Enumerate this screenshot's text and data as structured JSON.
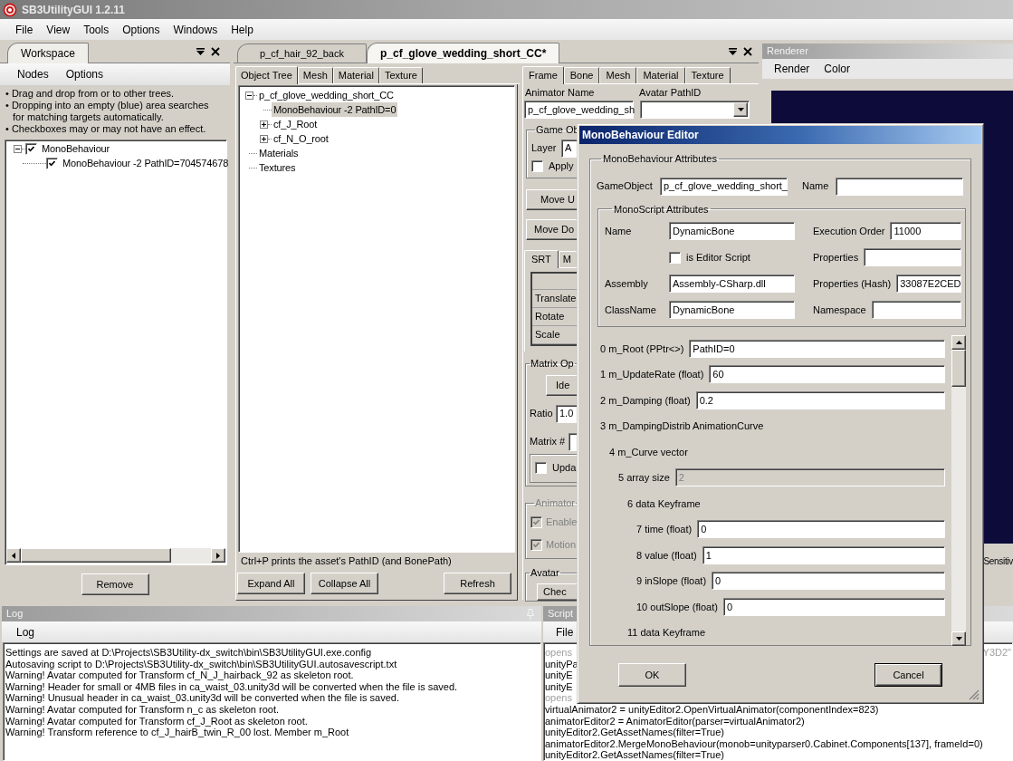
{
  "window": {
    "title": "SB3UtilityGUI 1.2.11"
  },
  "menu": [
    "File",
    "View",
    "Tools",
    "Options",
    "Windows",
    "Help"
  ],
  "workspace": {
    "tab": "Workspace",
    "menu": [
      "Nodes",
      "Options"
    ],
    "hints": [
      "• Drag and drop from or to other trees.",
      "• Dropping into an empty (blue) area searches for matching targets automatically.",
      "• Checkboxes may or may not have an effect."
    ],
    "tree": [
      {
        "label": "MonoBehaviour",
        "checked": true,
        "expanded": true,
        "children": [
          {
            "label": "MonoBehaviour -2 PathID=704574678",
            "checked": true
          }
        ]
      }
    ],
    "remove_button": "Remove"
  },
  "document_tabs": [
    {
      "label": "p_cf_hair_92_back",
      "selected": false
    },
    {
      "label": "p_cf_glove_wedding_short_CC*",
      "selected": true
    }
  ],
  "object_panel": {
    "tabs": [
      {
        "label": "Object Tree",
        "selected": true
      },
      {
        "label": "Mesh",
        "selected": false
      },
      {
        "label": "Material",
        "selected": false
      },
      {
        "label": "Texture",
        "selected": false
      }
    ],
    "tree": [
      {
        "label": "p_cf_glove_wedding_short_CC",
        "expanded": true,
        "selected": false,
        "children": [
          {
            "label": "MonoBehaviour -2 PathID=0",
            "selected": true
          },
          {
            "label": "cf_J_Root",
            "expanded": false,
            "selected": false
          },
          {
            "label": "cf_N_O_root",
            "expanded": false,
            "selected": false
          }
        ]
      },
      {
        "label": "Materials",
        "selected": false
      },
      {
        "label": "Textures",
        "selected": false
      }
    ],
    "hint": "Ctrl+P prints the asset's PathID (and BonePath)",
    "buttons_left": [
      "Expand All",
      "Collapse All"
    ],
    "buttons_right": [
      "Refresh"
    ]
  },
  "frame_panel": {
    "tabs": [
      {
        "label": "Frame",
        "selected": true
      },
      {
        "label": "Bone",
        "selected": false
      },
      {
        "label": "Mesh",
        "selected": false
      },
      {
        "label": "Material",
        "selected": false
      },
      {
        "label": "Texture",
        "selected": false
      }
    ],
    "animator_name_label": "Animator Name",
    "animator_name": "p_cf_glove_wedding_sh",
    "avatar_pathid_label": "Avatar PathID",
    "game_object_group": {
      "title": "Game Ob",
      "layer_label": "Layer",
      "layer_value": "A",
      "apply": {
        "label": "Apply",
        "checked": false
      }
    },
    "move_buttons": [
      "Move U",
      "Move Do"
    ],
    "transform_tabs": [
      {
        "label": "SRT",
        "selected": true
      },
      {
        "label": "M",
        "selected": false
      }
    ],
    "transform_rows": [
      "Translate",
      "Rotate",
      "Scale"
    ],
    "matrix_group": {
      "title": "Matrix Op",
      "identity_button": "Ide",
      "ratio_label": "Ratio",
      "ratio_value": "1.0",
      "matrix_label": "Matrix #",
      "update": {
        "label": "Upda",
        "checked": false
      }
    },
    "animator_group": {
      "title": "Animator",
      "disabled": true,
      "options": [
        {
          "label": "Enable",
          "checked": true
        },
        {
          "label": "Motion",
          "checked": true
        }
      ]
    },
    "avatar_group": {
      "title": "Avatar",
      "button": "Chec"
    }
  },
  "renderer": {
    "title": "Renderer",
    "menu": [
      "Render",
      "Color"
    ],
    "label": "Sensitiv"
  },
  "log": {
    "title": "Log",
    "menu": [
      "Log"
    ],
    "lines": [
      "Settings are saved at D:\\Projects\\SB3Utility-dx_switch\\bin\\SB3UtilityGUI.exe.config",
      "Autosaving script to D:\\Projects\\SB3Utility-dx_switch\\bin\\SB3UtilityGUI.autosavescript.txt",
      "Warning! Avatar computed for Transform cf_N_J_hairback_92 as skeleton root.",
      "Warning! Header for small or 4MB files in ca_waist_03.unity3d will be converted when the file is saved.",
      "Warning! Unusual header in ca_waist_03.unity3d will be converted when the file is saved.",
      "Warning! Avatar computed for Transform n_c as skeleton root.",
      "Warning! Avatar computed for Transform cf_J_Root as skeleton root.",
      "Warning! Transform reference to cf_J_hairB_twin_R_00 lost. Member m_Root"
    ]
  },
  "script": {
    "title": "Script",
    "menu": [
      "File"
    ],
    "lines": [
      {
        "text": "opens",
        "dimmed": true,
        "end": "Y3D2\""
      },
      {
        "text": "unityPa",
        "dimmed": false
      },
      {
        "text": "unityE",
        "dimmed": false
      },
      {
        "text": "unityE",
        "dimmed": false
      },
      {
        "text": "opens",
        "dimmed": true
      },
      {
        "text": "virtualAnimator2 = unityEditor2.OpenVirtualAnimator(componentIndex=823)",
        "dimmed": false
      },
      {
        "text": "animatorEditor2 = AnimatorEditor(parser=virtualAnimator2)",
        "dimmed": false
      },
      {
        "text": "unityEditor2.GetAssetNames(filter=True)",
        "dimmed": false
      },
      {
        "text": "animatorEditor2.MergeMonoBehaviour(monob=unityparser0.Cabinet.Components[137], frameId=0)",
        "dimmed": false
      },
      {
        "text": "unityEditor2.GetAssetNames(filter=True)",
        "dimmed": false
      }
    ]
  },
  "dialog": {
    "title": "MonoBehaviour Editor",
    "attributes_title": "MonoBehaviour Attributes",
    "gameobject_label": "GameObject",
    "gameobject_value": "p_cf_glove_wedding_short_",
    "name_label": "Name",
    "script_title": "MonoScript Attributes",
    "script_left": [
      {
        "kind": "field",
        "label": "Name",
        "value": "DynamicBone"
      },
      {
        "kind": "checkbox",
        "label": "is Editor Script",
        "checked": false
      },
      {
        "kind": "field",
        "label": "Assembly",
        "value": "Assembly-CSharp.dll"
      },
      {
        "kind": "field",
        "label": "ClassName",
        "value": "DynamicBone"
      }
    ],
    "script_right": [
      {
        "label": "Execution Order",
        "value": "11000"
      },
      {
        "label": "Properties"
      },
      {
        "label": "Properties (Hash)",
        "value": "33087E2CED"
      },
      {
        "label": "Namespace"
      }
    ],
    "members": [
      {
        "kind": "field",
        "label": "0 m_Root (PPtr<>)",
        "value": "PathID=0",
        "disabled": false
      },
      {
        "kind": "field",
        "label": "1 m_UpdateRate (float)",
        "value": "60",
        "disabled": false
      },
      {
        "kind": "field",
        "label": "2 m_Damping (float)",
        "value": "0.2",
        "disabled": false
      },
      {
        "kind": "group",
        "label": "3 m_DampingDistrib AnimationCurve",
        "children": [
          {
            "kind": "group",
            "label": "4 m_Curve vector",
            "children": [
              {
                "kind": "field",
                "label": "5 array size",
                "value": "2",
                "disabled": true,
                "children": [
                  {
                    "kind": "group",
                    "label": "6 data Keyframe",
                    "children": [
                      {
                        "kind": "field",
                        "label": "7 time (float)",
                        "value": "0",
                        "disabled": false
                      },
                      {
                        "kind": "field",
                        "label": "8 value (float)",
                        "value": "1",
                        "disabled": false
                      },
                      {
                        "kind": "field",
                        "label": "9 inSlope (float)",
                        "value": "0",
                        "disabled": false
                      },
                      {
                        "kind": "field",
                        "label": "10 outSlope (float)",
                        "value": "0",
                        "disabled": false
                      }
                    ]
                  },
                  {
                    "kind": "group",
                    "label": "11 data Keyframe"
                  }
                ]
              }
            ]
          }
        ]
      }
    ],
    "buttons": [
      {
        "label": "OK",
        "default": false
      },
      {
        "label": "Cancel",
        "default": true
      }
    ]
  }
}
